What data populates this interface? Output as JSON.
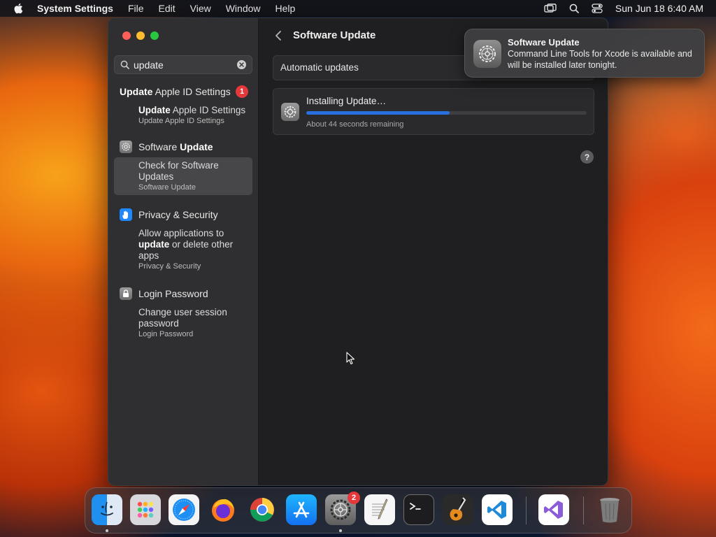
{
  "menubar": {
    "app_name": "System Settings",
    "menus": [
      "File",
      "Edit",
      "View",
      "Window",
      "Help"
    ],
    "clock": "Sun Jun 18  6:40 AM"
  },
  "sidebar": {
    "search_value": "update",
    "groups": [
      {
        "head_bold": "Update",
        "head_rest": " Apple ID Settings",
        "badge": "1",
        "results": [
          {
            "bold": "Update",
            "rest": " Apple ID Settings",
            "sub": "Update Apple ID Settings"
          }
        ]
      },
      {
        "head_rest": "Software ",
        "head_bold": "Update",
        "results": [
          {
            "text": "Check for Software Updates",
            "sub": "Software Update"
          }
        ]
      },
      {
        "head": "Privacy & Security",
        "results": [
          {
            "pre": "Allow applications to ",
            "bold": "update",
            "post": " or delete other apps",
            "sub": "Privacy & Security"
          }
        ]
      },
      {
        "head": "Login Password",
        "results": [
          {
            "text": "Change user session password",
            "sub": "Login Password"
          }
        ]
      }
    ]
  },
  "main": {
    "title": "Software Update",
    "automatic_updates_label": "Automatic updates",
    "install": {
      "title": "Installing Update…",
      "progress_fraction": 0.51,
      "remaining": "About 44 seconds remaining"
    },
    "help_label": "?"
  },
  "notification": {
    "title": "Software Update",
    "body": "Command Line Tools for Xcode is available and will be installed later tonight."
  },
  "dock": {
    "settings_badge": "2"
  },
  "colors": {
    "progress_fill": "#2a6fe0",
    "badge_red": "#e5383b",
    "accent_blue": "#1e88ff"
  }
}
